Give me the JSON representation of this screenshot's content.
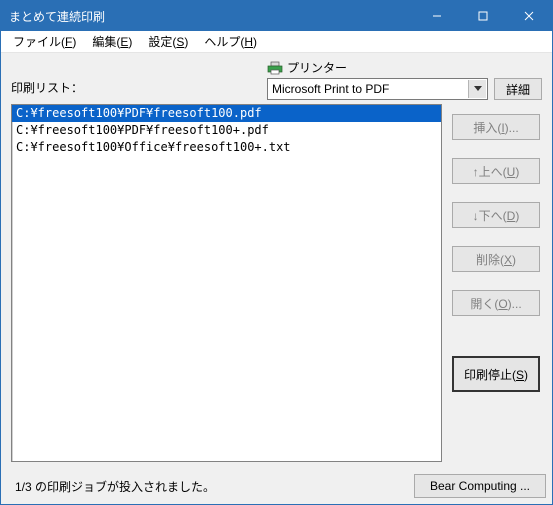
{
  "window": {
    "title": "まとめて連続印刷"
  },
  "menu": {
    "file": "ファイル(F)",
    "edit": "編集(E)",
    "settings": "設定(S)",
    "help": "ヘルプ(H)"
  },
  "labels": {
    "print_list": "印刷リスト：",
    "printer": "プリンター"
  },
  "printer": {
    "selected": "Microsoft Print to PDF",
    "detail_btn": "詳細"
  },
  "list": {
    "items": [
      "C:¥freesoft100¥PDF¥freesoft100.pdf",
      "C:¥freesoft100¥PDF¥freesoft100+.pdf",
      "C:¥freesoft100¥Office¥freesoft100+.txt"
    ],
    "selected_index": 0
  },
  "side": {
    "insert": "挿入(I)...",
    "up": "↑上へ(U)",
    "down": "↓下へ(D)",
    "delete": "削除(X)",
    "open": "開く(O)...",
    "stop": "印刷停止(S)"
  },
  "footer": {
    "status": "1/3 の印刷ジョブが投入されました。",
    "brand": "Bear Computing ..."
  }
}
